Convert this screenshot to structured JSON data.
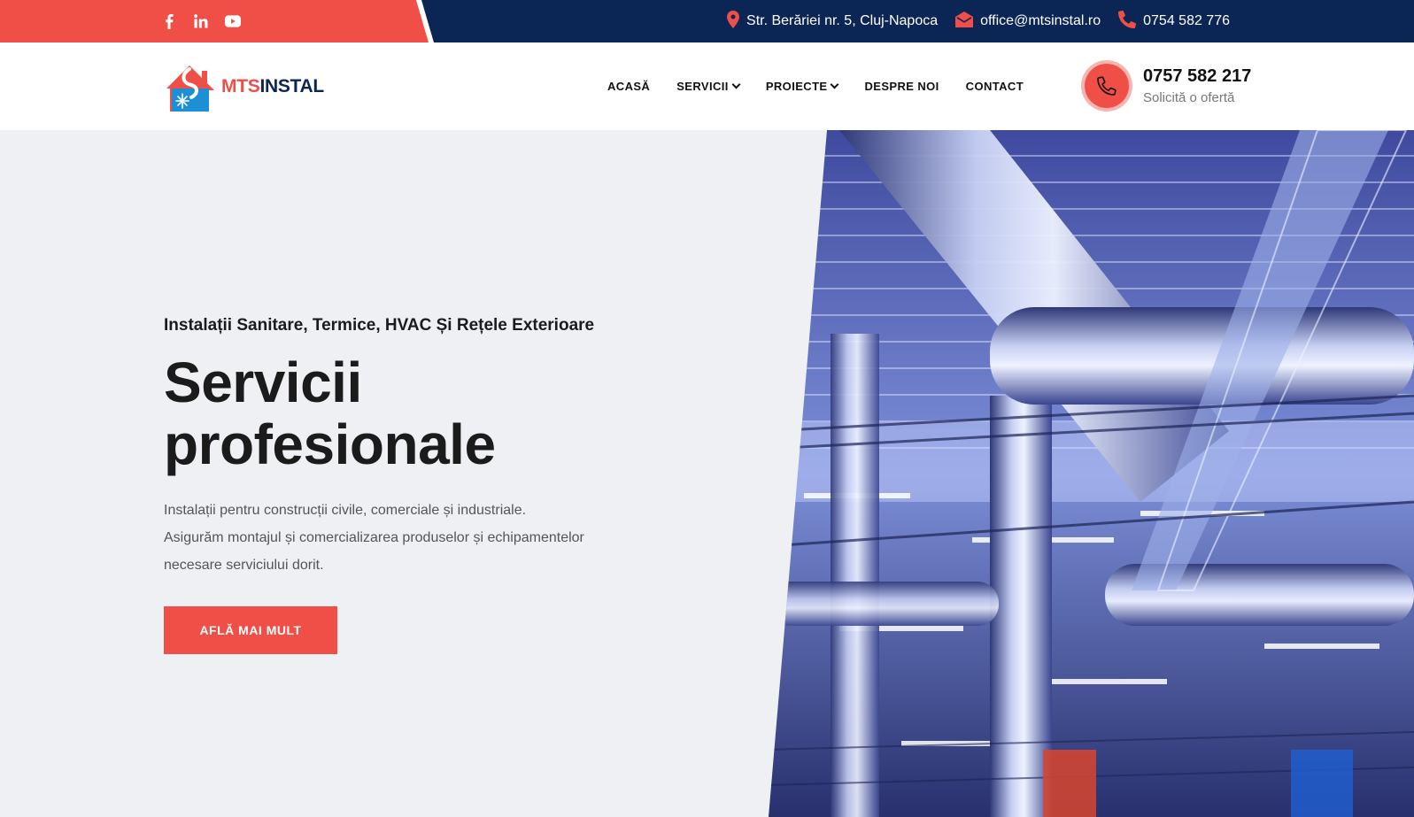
{
  "topbar": {
    "social": [
      "facebook-icon",
      "linkedin-icon",
      "youtube-icon"
    ],
    "address": "Str. Berăriei nr. 5, Cluj-Napoca",
    "email": "office@mtsinstal.ro",
    "phone": "0754 582 776"
  },
  "header": {
    "logo_primary": "MTS",
    "logo_secondary": "INSTAL",
    "nav": [
      {
        "label": "ACASĂ"
      },
      {
        "label": "SERVICII"
      },
      {
        "label": "PROIECTE"
      },
      {
        "label": "DESPRE NOI"
      },
      {
        "label": "CONTACT"
      }
    ],
    "cta_phone": "0757 582 217",
    "cta_sub": "Solicită o ofertă"
  },
  "hero": {
    "subtitle": "Instalații Sanitare, Termice, HVAC Și Rețele Exterioare",
    "title_line1": "Servicii",
    "title_line2": "profesionale",
    "desc_line1": "Instalații pentru construcții civile, comerciale și industriale.",
    "desc_line2": "Asigurăm montajul și comercializarea produselor și echipamentelor",
    "desc_line3": "necesare serviciului dorit.",
    "button": "AFLĂ MAI MULT"
  },
  "colors": {
    "accent": "#ef4f47",
    "navy": "#0b2554",
    "background": "#eef0f4"
  }
}
